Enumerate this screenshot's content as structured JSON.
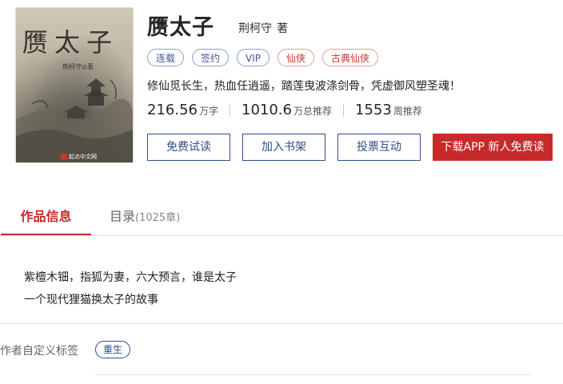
{
  "book": {
    "title": "赝太子",
    "author": "荆柯守",
    "author_suffix": "著",
    "cover": {
      "title_text": "赝太子",
      "author_text": "荆柯守◎著",
      "publisher_text": "起点中文网"
    },
    "tags": [
      {
        "label": "连载",
        "style": "blue"
      },
      {
        "label": "签约",
        "style": "blue"
      },
      {
        "label": "VIP",
        "style": "blue"
      },
      {
        "label": "仙侠",
        "style": "red"
      },
      {
        "label": "古典仙侠",
        "style": "red"
      }
    ],
    "intro": "修仙觅长生，热血任逍遥，踏莲曳波涤剑骨，凭虚御风塑圣魂！",
    "stats": [
      {
        "value": "216.56",
        "unit": "万字"
      },
      {
        "value": "1010.6",
        "unit": "万总推荐"
      },
      {
        "value": "1553",
        "unit": "周推荐"
      }
    ]
  },
  "actions": {
    "free_read": "免费试读",
    "add_shelf": "加入书架",
    "vote": "投票互动",
    "download_app": "下载APP 新人免费读"
  },
  "tabs": {
    "info": "作品信息",
    "catalog": "目录",
    "catalog_count": "(1025章)"
  },
  "description": {
    "line1": "紫檀木钿，指狐为妻，六大预言，谁是太子",
    "line2": "一个现代狸猫换太子的故事"
  },
  "custom_tags": {
    "label": "作者自定义标签",
    "items": [
      "重生"
    ]
  },
  "colors": {
    "accent_red": "#c72a2a",
    "accent_blue": "#2f4f8a"
  }
}
